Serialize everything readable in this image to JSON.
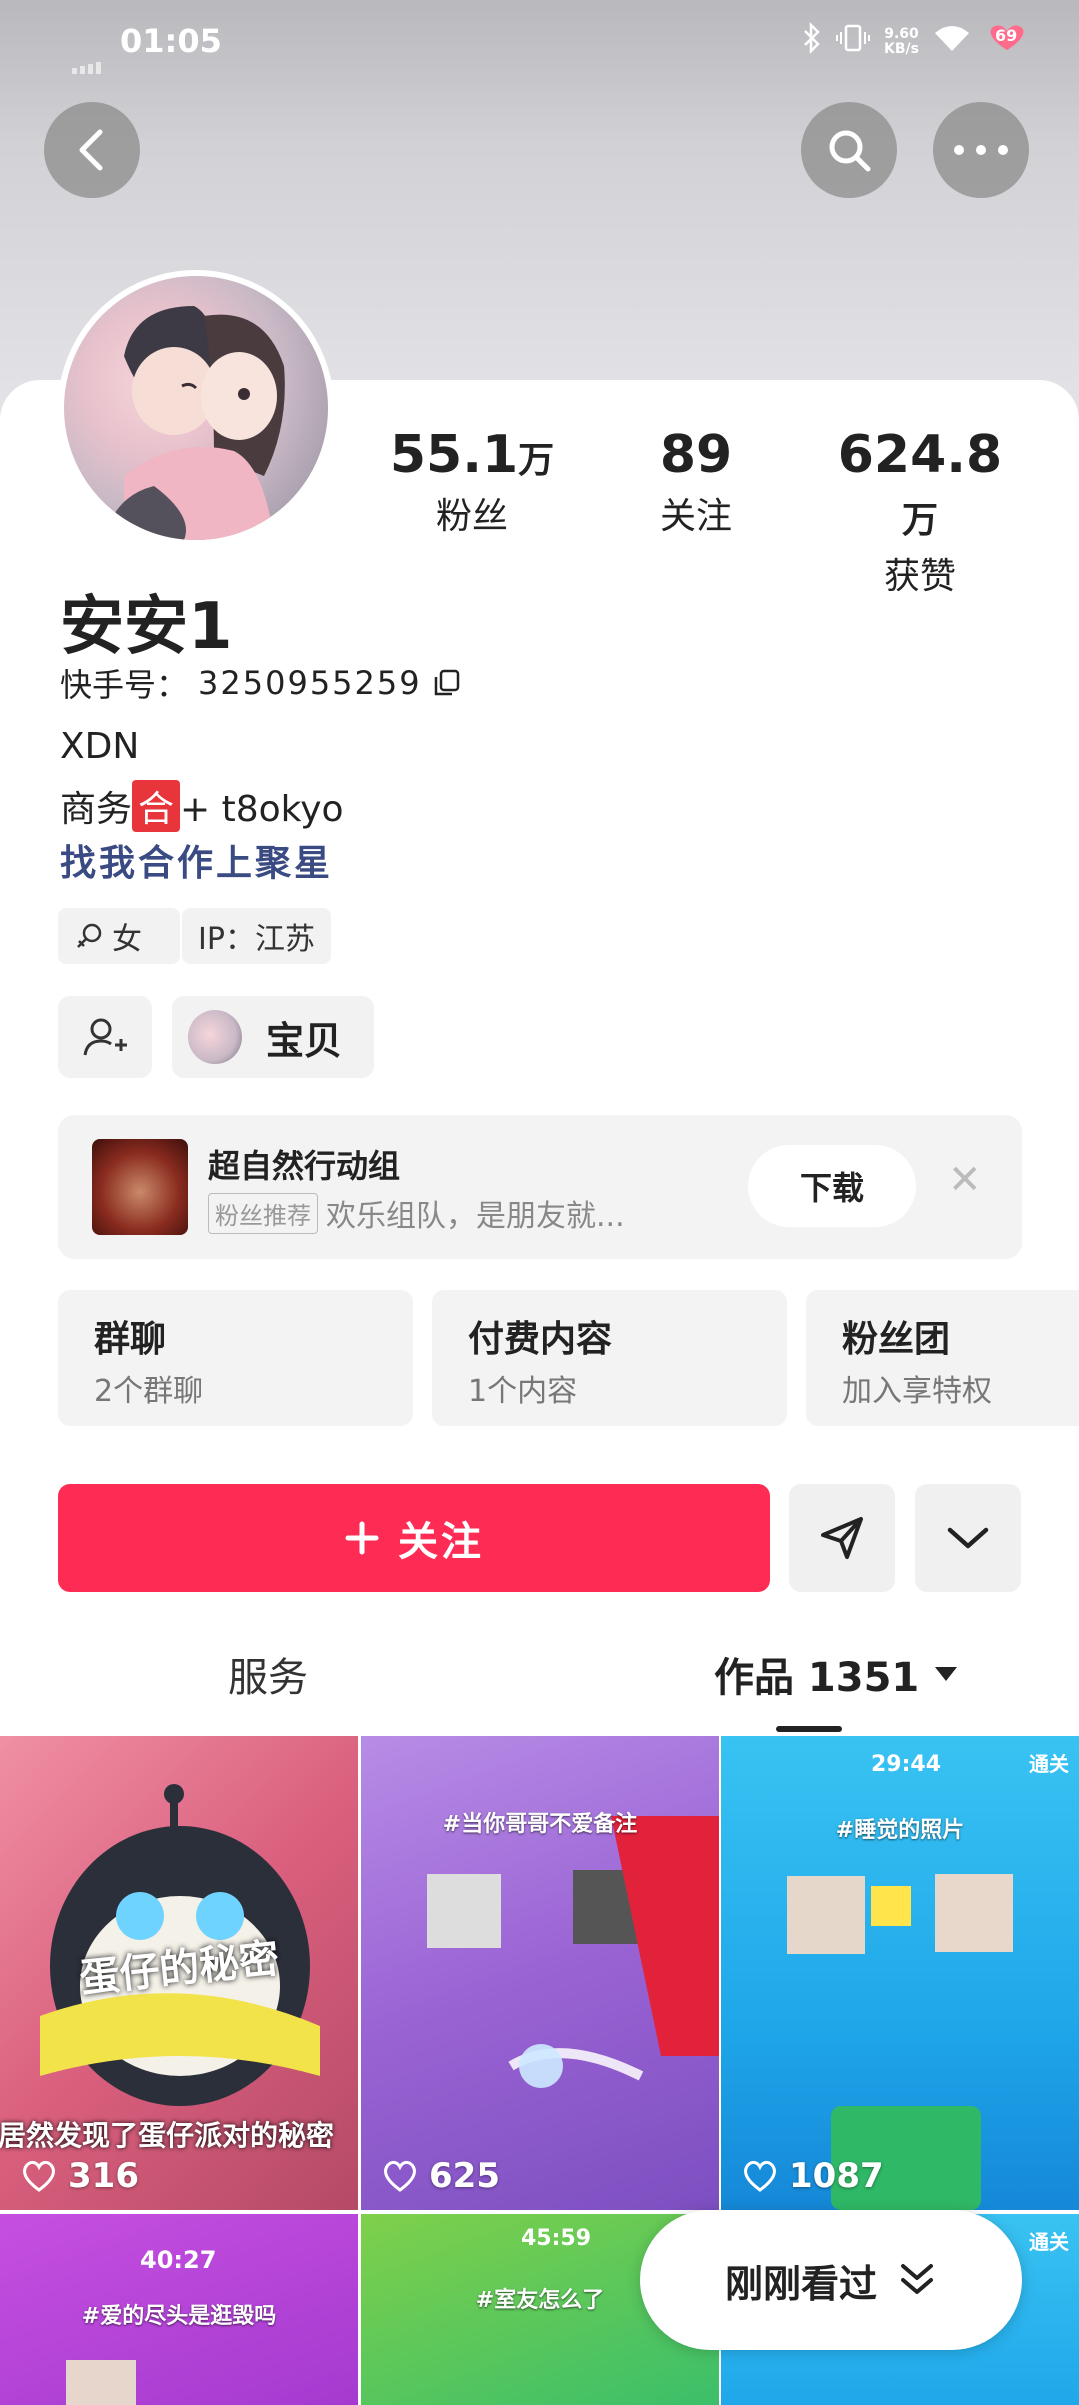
{
  "status_bar": {
    "time": "01:05",
    "net_speed": "9.60\nKB/s",
    "battery": "69"
  },
  "profile": {
    "name": "安安1",
    "kuaishou_id_label": "快手号：",
    "kuaishou_id": "3250955259",
    "stats": [
      {
        "num": "55.1",
        "unit": "万",
        "label": "粉丝"
      },
      {
        "num": "89",
        "unit": "",
        "label": "关注"
      },
      {
        "num": "624.8",
        "unit": "万",
        "label": "获赞"
      }
    ],
    "bio_line1": "XDN",
    "bio_line2_prefix": "商务",
    "bio_line2_badge": "合",
    "bio_line2_suffix": "+ t8okyo",
    "bio_link": "找我合作上聚星",
    "tag_gender": "女",
    "tag_ip": "IP：江苏",
    "baby_label": "宝贝"
  },
  "promo": {
    "title": "超自然行动组",
    "chip": "粉丝推荐",
    "desc": "欢乐组队，是朋友就...",
    "download": "下载",
    "close": "✕"
  },
  "features": [
    {
      "title": "群聊",
      "sub": "2个群聊"
    },
    {
      "title": "付费内容",
      "sub": "1个内容"
    },
    {
      "title": "粉丝团",
      "sub": "加入享特权"
    }
  ],
  "follow_label": "关注",
  "tabs": {
    "service": "服务",
    "works": "作品 1351"
  },
  "videos": [
    {
      "likes": "316",
      "caption": "蛋仔的秘密",
      "overlay": "我居然发现了蛋仔派对的秘密",
      "hashtag": ""
    },
    {
      "likes": "625",
      "caption": "",
      "overlay": "",
      "hashtag": "#当你哥哥不爱备注"
    },
    {
      "likes": "1087",
      "caption": "",
      "overlay": "",
      "hashtag": "#睡觉的照片",
      "timer": "29:44",
      "badge": "通关"
    },
    {
      "likes": "",
      "caption": "",
      "overlay": "",
      "hashtag": "#爱的尽头是逛毁吗",
      "timer": "40:27"
    },
    {
      "likes": "",
      "caption": "",
      "overlay": "",
      "hashtag": "#室友怎么了",
      "timer": "45:59"
    },
    {
      "likes": "",
      "caption": "",
      "overlay": "",
      "hashtag": "",
      "badge": "通关"
    }
  ],
  "recent_label": "刚刚看过",
  "colors": {
    "accent": "#fe2c55",
    "link": "#3a4a82",
    "badge_red": "#e8353b"
  }
}
